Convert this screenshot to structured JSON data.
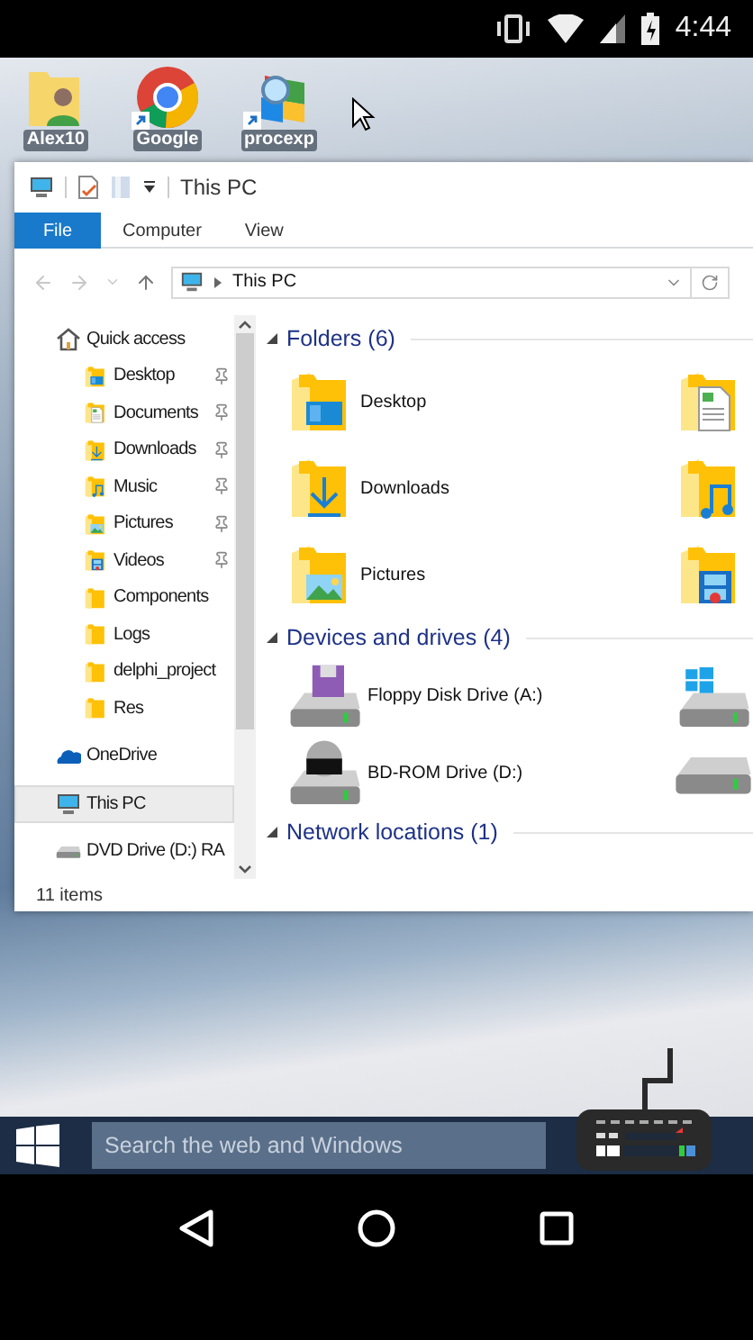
{
  "status_bar": {
    "time": "4:44"
  },
  "desktop_icons": [
    {
      "kind": "user-folder",
      "label": "Alex10",
      "shortcut": false
    },
    {
      "kind": "browser",
      "label": "Google",
      "shortcut": true
    },
    {
      "kind": "process",
      "label": "procexp",
      "shortcut": true
    }
  ],
  "explorer": {
    "title": "This PC",
    "ribbon_tabs": [
      {
        "label": "File",
        "selected": true
      },
      {
        "label": "Computer",
        "selected": false
      },
      {
        "label": "View",
        "selected": false
      }
    ],
    "address": {
      "path": "This PC"
    },
    "navigation": [
      {
        "kind": "quick",
        "label": "Quick access",
        "selected": false,
        "children": [
          {
            "kind": "desktop",
            "label": "Desktop",
            "pinned": true,
            "selected": false
          },
          {
            "kind": "documents",
            "label": "Documents",
            "pinned": true,
            "selected": false
          },
          {
            "kind": "downloads",
            "label": "Downloads",
            "pinned": true,
            "selected": false
          },
          {
            "kind": "music",
            "label": "Music",
            "pinned": true,
            "selected": false
          },
          {
            "kind": "pictures",
            "label": "Pictures",
            "pinned": true,
            "selected": false
          },
          {
            "kind": "videos",
            "label": "Videos",
            "pinned": true,
            "selected": false
          },
          {
            "kind": "folder",
            "label": "Components",
            "pinned": false,
            "selected": false
          },
          {
            "kind": "folder",
            "label": "Logs",
            "pinned": false,
            "selected": false
          },
          {
            "kind": "folder",
            "label": "delphi_project",
            "pinned": false,
            "selected": false
          },
          {
            "kind": "folder",
            "label": "Res",
            "pinned": false,
            "selected": false
          }
        ]
      },
      {
        "kind": "onedrive",
        "label": "OneDrive",
        "selected": false
      },
      {
        "kind": "pc",
        "label": "This PC",
        "selected": true
      },
      {
        "kind": "dvd",
        "label": "DVD Drive (D:) RA",
        "selected": false
      }
    ],
    "groups": [
      {
        "title": "Folders (6)",
        "expanded": true,
        "items": [
          {
            "kind": "desktop",
            "label": "Desktop"
          },
          {
            "kind": "documents"
          },
          {
            "kind": "downloads",
            "label": "Downloads"
          },
          {
            "kind": "music"
          },
          {
            "kind": "pictures",
            "label": "Pictures"
          },
          {
            "kind": "videos"
          }
        ]
      },
      {
        "title": "Devices and drives (4)",
        "expanded": true,
        "items": [
          {
            "kind": "floppy",
            "label": "Floppy Disk Drive (A:)"
          },
          {
            "kind": "system-drive"
          },
          {
            "kind": "bd",
            "label": "BD-ROM Drive (D:)"
          },
          {
            "kind": "drive"
          }
        ]
      },
      {
        "title": "Network locations (1)",
        "expanded": true
      }
    ],
    "status": "11 items"
  },
  "taskbar": {
    "search": {
      "placeholder": "Search the web and Windows"
    }
  }
}
